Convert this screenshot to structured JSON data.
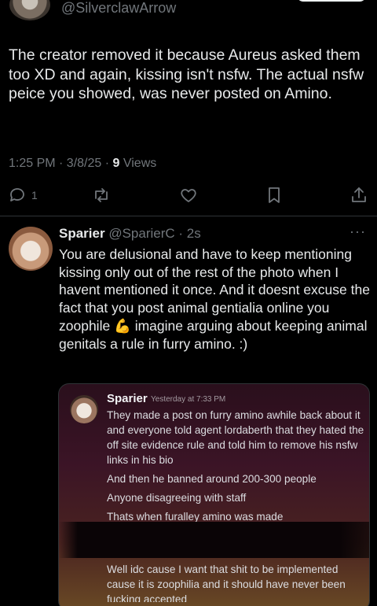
{
  "top": {
    "handle": "@SilverclawArrow"
  },
  "tweet": {
    "text": "The creator removed it because Aureus asked them too XD and again, kissing isn't nsfw. The actual nsfw peice you showed, was never posted on Amino.",
    "time": "1:25 PM · 3/8/25 · ",
    "views_count": "9",
    "views_label": " Views"
  },
  "actions": {
    "reply_count": "1",
    "icons": [
      "reply-icon",
      "retweet-icon",
      "like-icon",
      "bookmark-icon",
      "share-icon"
    ]
  },
  "reply": {
    "name": "Sparier",
    "handle": " @SparierC · 2s",
    "more": "···",
    "text": "You are delusional and have to keep mentioning kissing only out of the rest of the photo when I havent mentioned it once. And it doesnt excuse the fact that you post animal gentialia online you zoophile 💪 imagine arguing about keeping animal genitals a rule in furry amino. :)"
  },
  "card": {
    "name": "Sparier",
    "time": "Yesterday at 7:33 PM",
    "lines": [
      "They made a post on furry amino awhile back about it and everyone told agent lordaberth that they hated the off site evidence rule and told him to remove his nsfw links in his bio",
      "And then he banned around 200-300 people",
      "Anyone disagreeing with staff",
      "Thats when furalley amino was made"
    ],
    "bottom_1": "Well idc cause I want that shit to be implemented cause it is zoophilia and it should have never been",
    "bottom_2": "fucking accepted"
  },
  "colors": {
    "background": "#000000",
    "text": "#e7e9ea",
    "muted": "#71767b",
    "divider": "#2f3336"
  }
}
